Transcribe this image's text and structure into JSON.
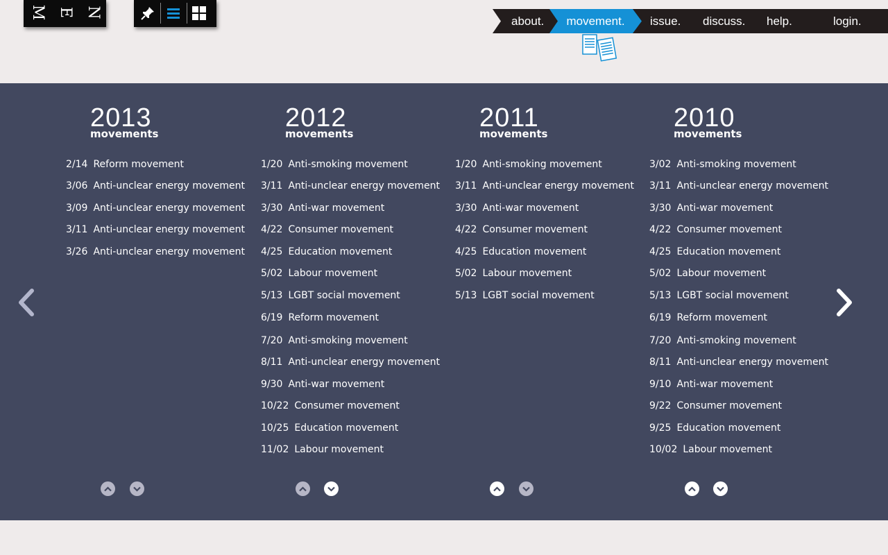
{
  "menu": {
    "letters": [
      "M",
      "E",
      "N"
    ]
  },
  "tools": {
    "icons": [
      "pin-icon",
      "list-view-icon",
      "grid-view-icon"
    ],
    "active": "list-view-icon"
  },
  "nav": {
    "items": [
      "about.",
      "movement.",
      "issue.",
      "discuss.",
      "help.",
      "login."
    ],
    "active": "movement."
  },
  "colors": {
    "accent": "#1591d6",
    "panel": "#42485f",
    "page": "#efebeb",
    "nav": "#231d1d"
  },
  "columns": [
    {
      "year": "2013",
      "subtitle": "movements",
      "entries": [
        {
          "date": "2/14",
          "label": "Reform movement"
        },
        {
          "date": "3/06",
          "label": "Anti-unclear energy movement"
        },
        {
          "date": "3/09",
          "label": "Anti-unclear energy movement"
        },
        {
          "date": "3/11",
          "label": "Anti-unclear energy movement"
        },
        {
          "date": "3/26",
          "label": "Anti-unclear energy movement"
        }
      ]
    },
    {
      "year": "2012",
      "subtitle": "movements",
      "entries": [
        {
          "date": "1/20",
          "label": "Anti-smoking movement"
        },
        {
          "date": "3/11",
          "label": "Anti-unclear energy movement"
        },
        {
          "date": "3/30",
          "label": "Anti-war movement"
        },
        {
          "date": "4/22",
          "label": "Consumer movement"
        },
        {
          "date": "4/25",
          "label": "Education movement"
        },
        {
          "date": "5/02",
          "label": "Labour movement"
        },
        {
          "date": "5/13",
          "label": "LGBT social movement"
        },
        {
          "date": "6/19",
          "label": "Reform movement"
        },
        {
          "date": "7/20",
          "label": "Anti-smoking movement"
        },
        {
          "date": "8/11",
          "label": "Anti-unclear energy movement"
        },
        {
          "date": "9/30",
          "label": "Anti-war movement"
        },
        {
          "date": "10/22",
          "label": "Consumer movement"
        },
        {
          "date": "10/25",
          "label": "Education movement"
        },
        {
          "date": "11/02",
          "label": "Labour movement"
        }
      ]
    },
    {
      "year": "2011",
      "subtitle": "movements",
      "entries": [
        {
          "date": "1/20",
          "label": "Anti-smoking movement"
        },
        {
          "date": "3/11",
          "label": "Anti-unclear energy movement"
        },
        {
          "date": "3/30",
          "label": "Anti-war movement"
        },
        {
          "date": "4/22",
          "label": "Consumer movement"
        },
        {
          "date": "4/25",
          "label": "Education movement"
        },
        {
          "date": "5/02",
          "label": "Labour movement"
        },
        {
          "date": "5/13",
          "label": "LGBT social movement"
        }
      ]
    },
    {
      "year": "2010",
      "subtitle": "movements",
      "entries": [
        {
          "date": "3/02",
          "label": "Anti-smoking movement"
        },
        {
          "date": "3/11",
          "label": "Anti-unclear energy movement"
        },
        {
          "date": "3/30",
          "label": "Anti-war movement"
        },
        {
          "date": "4/22",
          "label": "Consumer movement"
        },
        {
          "date": "4/25",
          "label": "Education movement"
        },
        {
          "date": "5/02",
          "label": "Labour movement"
        },
        {
          "date": "5/13",
          "label": "LGBT social movement"
        },
        {
          "date": "6/19",
          "label": "Reform movement"
        },
        {
          "date": "7/20",
          "label": "Anti-smoking movement"
        },
        {
          "date": "8/11",
          "label": "Anti-unclear energy movement"
        },
        {
          "date": "9/10",
          "label": "Anti-war movement"
        },
        {
          "date": "9/22",
          "label": "Consumer movement"
        },
        {
          "date": "9/25",
          "label": "Education movement"
        },
        {
          "date": "10/02",
          "label": "Labour movement"
        }
      ]
    }
  ],
  "scroll_controls": [
    {
      "up": "dim",
      "down": "dim"
    },
    {
      "up": "dim",
      "down": "bright"
    },
    {
      "up": "bright",
      "down": "dim"
    },
    {
      "up": "bright",
      "down": "bright"
    }
  ],
  "pager": {
    "prev_icon": "chevron-left-icon",
    "next_icon": "chevron-right-icon"
  }
}
